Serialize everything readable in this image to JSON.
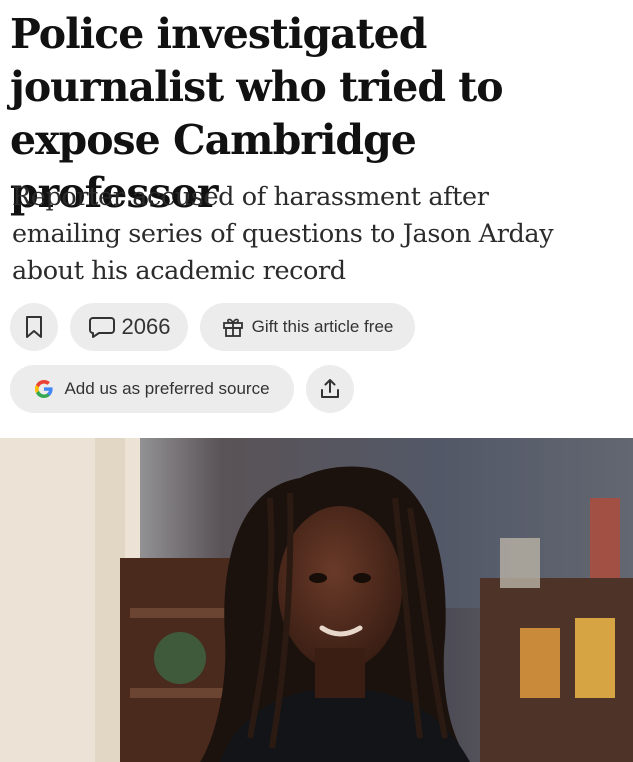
{
  "article": {
    "headline_lines": [
      "Police investigated",
      "journalist who tried to",
      "expose Cambridge professor"
    ],
    "standfirst_lines": [
      "Reporter accused of harassment after",
      "emailing series of questions to Jason Arday",
      "about his academic record"
    ]
  },
  "actions": {
    "bookmark_icon": "bookmark-icon",
    "comment_icon": "speech-bubble-icon",
    "comment_count": "2066",
    "gift_icon": "gift-icon",
    "gift_label": "Gift this article free",
    "source_icon": "google-g-icon",
    "source_label": "Add us as preferred source",
    "share_icon": "share-icon"
  },
  "colors": {
    "pill_background": "#ececec",
    "text": "#111111",
    "google_blue": "#4285F4",
    "google_red": "#EA4335",
    "google_yellow": "#FBBC05",
    "google_green": "#34A853"
  }
}
